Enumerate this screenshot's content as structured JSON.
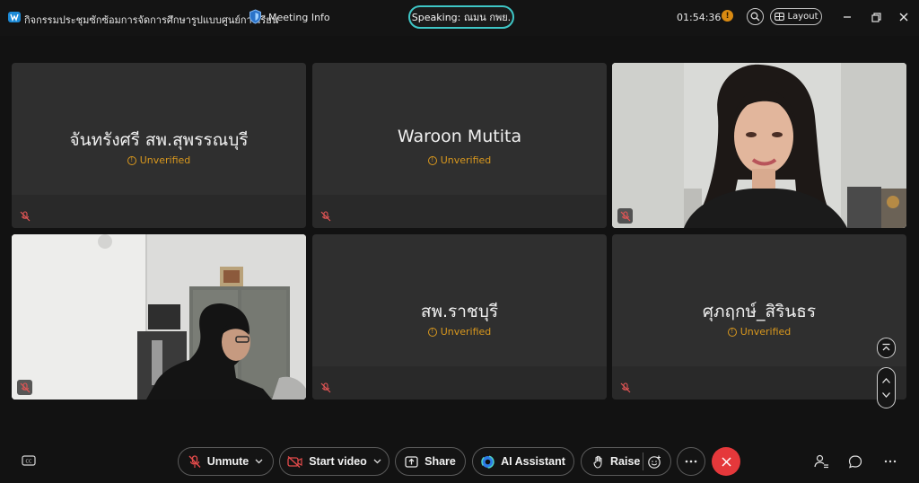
{
  "titlebar": {
    "meeting_title": "กิจกรรมประชุมซักซ้อมการจัดการศึกษารูปแบบศูนย์การเรียน",
    "meeting_info_label": "Meeting Info",
    "speaking": "Speaking: ณมน กพย.",
    "timer": "01:54:36",
    "status_letter": "!",
    "layout_label": "Layout"
  },
  "participants": [
    {
      "name": "จันทรังศรี สพ.สุพรรณบุรี",
      "badge": "Unverified",
      "muted": true
    },
    {
      "name": "Waroon Mutita",
      "badge": "Unverified",
      "muted": true
    },
    {
      "name": "",
      "badge": "",
      "muted": true,
      "video": true
    },
    {
      "name": "",
      "badge": "",
      "muted": true,
      "video": true
    },
    {
      "name": "สพ.ราชบุรี",
      "badge": "Unverified",
      "muted": true
    },
    {
      "name": "ศุภฤกษ์_สิรินธร",
      "badge": "Unverified",
      "muted": true
    }
  ],
  "toolbar": {
    "unmute_label": "Unmute",
    "start_video_label": "Start video",
    "share_label": "Share",
    "ai_assistant_label": "AI Assistant",
    "raise_label": "Raise"
  },
  "colors": {
    "accent_teal": "#3ec6c6",
    "end_call_red": "#e5383b",
    "unverified_orange": "#d9981e",
    "status_orange": "#d98a12"
  },
  "icons": [
    "webex-logo-icon",
    "shield-icon",
    "zoom-icon",
    "layout-icon",
    "minimize-icon",
    "restore-icon",
    "close-icon",
    "mic-muted-icon",
    "video-off-icon",
    "share-icon",
    "ai-assistant-icon",
    "raise-hand-icon",
    "reaction-icon",
    "more-icon",
    "end-call-icon",
    "participants-icon",
    "chat-icon",
    "captions-icon",
    "chevron-up-icon",
    "chevron-down-icon",
    "scroll-top-icon"
  ]
}
